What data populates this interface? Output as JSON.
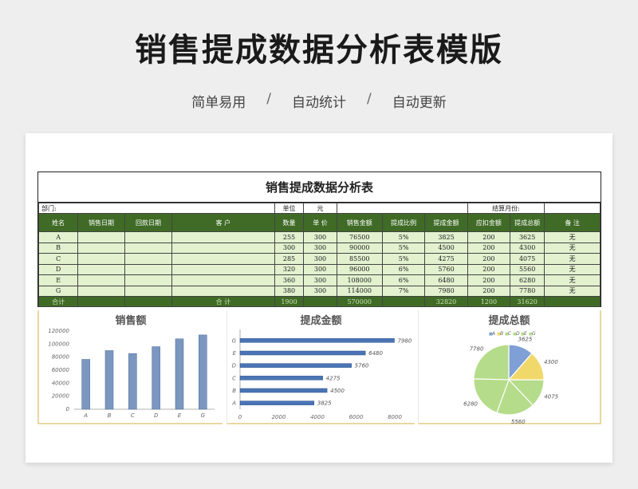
{
  "page": {
    "title": "销售提成数据分析表模版",
    "tags": [
      "简单易用",
      "自动统计",
      "自动更新"
    ],
    "separator": "/"
  },
  "sheet": {
    "title": "销售提成数据分析表",
    "meta": {
      "dept_label": "部门:",
      "unit_label": "单位",
      "unit_value": "元",
      "settle_label": "结算月份:"
    },
    "headers": [
      "姓名",
      "销售日期",
      "回款日期",
      "客  户",
      "数量",
      "单 价",
      "销售金额",
      "提成比例",
      "提成金额",
      "应扣金额",
      "提成总额",
      "备 注"
    ],
    "rows": [
      [
        "A",
        "",
        "",
        "",
        "255",
        "300",
        "76500",
        "5%",
        "3825",
        "200",
        "3625",
        "无"
      ],
      [
        "B",
        "",
        "",
        "",
        "300",
        "300",
        "90000",
        "5%",
        "4500",
        "200",
        "4300",
        "无"
      ],
      [
        "C",
        "",
        "",
        "",
        "285",
        "300",
        "85500",
        "5%",
        "4275",
        "200",
        "4075",
        "无"
      ],
      [
        "D",
        "",
        "",
        "",
        "320",
        "300",
        "96000",
        "6%",
        "5760",
        "200",
        "5560",
        "无"
      ],
      [
        "E",
        "",
        "",
        "",
        "360",
        "300",
        "108000",
        "6%",
        "6480",
        "200",
        "6280",
        "无"
      ],
      [
        "G",
        "",
        "",
        "",
        "380",
        "300",
        "114000",
        "7%",
        "7980",
        "200",
        "7780",
        "无"
      ]
    ],
    "total": {
      "label": "合计",
      "customer_label": "合    计",
      "qty": "1900",
      "amount": "570000",
      "commission": "32820",
      "deduction": "1200",
      "net": "31620"
    }
  },
  "chart_data": [
    {
      "type": "bar",
      "title": "销售额",
      "categories": [
        "A",
        "B",
        "C",
        "D",
        "E",
        "G"
      ],
      "values": [
        76500,
        90000,
        85500,
        96000,
        108000,
        114000
      ],
      "ylim": [
        0,
        120000
      ],
      "yticks": [
        "0",
        "20000",
        "40000",
        "60000",
        "80000",
        "100000",
        "120000"
      ],
      "color": "#7b97c0"
    },
    {
      "type": "bar",
      "orientation": "horizontal",
      "title": "提成金额",
      "categories": [
        "A",
        "B",
        "C",
        "D",
        "E",
        "G"
      ],
      "values": [
        3825,
        4500,
        4275,
        5760,
        6480,
        7980
      ],
      "xlim": [
        0,
        8000
      ],
      "xticks": [
        "0",
        "2000",
        "4000",
        "6000",
        "8000"
      ],
      "color": "#4a74b4"
    },
    {
      "type": "pie",
      "title": "提成总额",
      "categories": [
        "A",
        "B",
        "C",
        "D",
        "E",
        "G"
      ],
      "legend": [
        "A",
        "B",
        "C",
        "D",
        "E",
        "G"
      ],
      "legend_markers": [
        "■",
        "■",
        "■",
        "■",
        "■",
        "■"
      ],
      "values": [
        3625,
        4300,
        4075,
        5560,
        6280,
        7780
      ],
      "colors": [
        "#7fa0d6",
        "#f1d86a",
        "#b5dc8a",
        "#b5dc8a",
        "#b5dc8a",
        "#b5dc8a"
      ],
      "legend_position": "top"
    }
  ]
}
